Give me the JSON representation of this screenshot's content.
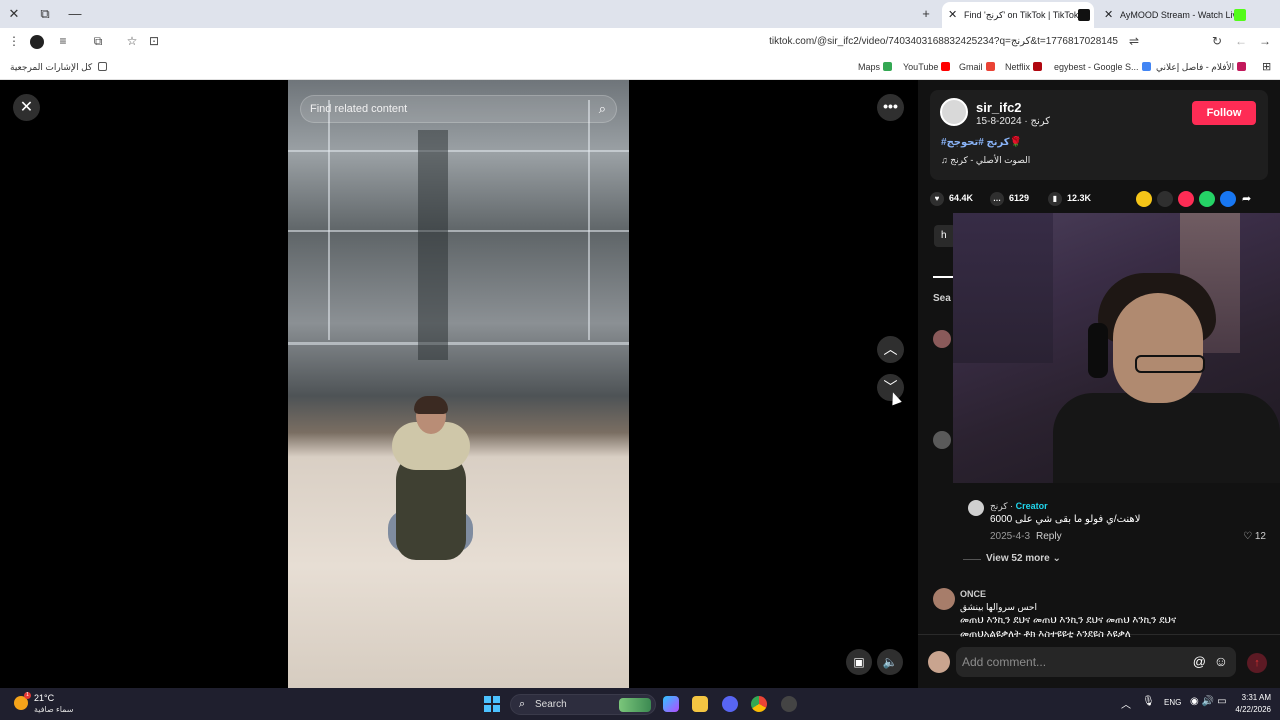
{
  "window": {
    "close": "✕",
    "restore": "⧉",
    "minimize": "—",
    "new_tab": "+"
  },
  "tabs": [
    {
      "label": "Find 'كرنج' on TikTok | TikTok",
      "icon": "tiktok-icon",
      "active": true
    },
    {
      "label": "AyMOOD Stream - Watch Live",
      "icon": "kick-icon",
      "active": false
    }
  ],
  "toolbar": {
    "url": "tiktok.com/@sir_ifc2/video/7403403168832425234?q=كرنج&t=1776817028145"
  },
  "bookmarks": {
    "all": "كل الإشارات المرجعية",
    "items": [
      "Maps",
      "YouTube",
      "Gmail",
      "Netflix",
      "egybest - Google S...",
      "الأفلام - فاصل إعلاني"
    ]
  },
  "video": {
    "search_placeholder": "Find related content"
  },
  "post": {
    "username": "sir_ifc2",
    "subline": "كرنج · 2024-8-15",
    "follow": "Follow",
    "hashtags": "#كرنج #تحوجج🌹",
    "sound": "♫ الصوت الأصلي - كرنج",
    "likes": "64.4K",
    "comments": "6129",
    "saves": "12.3K"
  },
  "comments": {
    "tab_partial": "h",
    "search_partial": "Sea",
    "creator_reply": {
      "name": "كرنج",
      "creator_label": "Creator",
      "text": "لاهنت/ي فولو ما بقى شي على 6000",
      "date": "2025-4-3",
      "reply": "Reply",
      "likes": "12"
    },
    "view_more": "View 52 more",
    "second": {
      "name": "ONCE",
      "line1": "احس سروالها بينشق",
      "line2": "መጠህ እንኪን ደህና መጠህ እንኪን ደህና መጠህ እንኪን ደህና",
      "line3": "መጠህአልዩቃለት ቶክ እስተዩዩቲ እንደዩስ እዩቃለ"
    },
    "input_placeholder": "Add comment..."
  },
  "taskbar": {
    "temp": "21°C",
    "condition": "سماء صافية",
    "search": "Search",
    "lang": "ENG",
    "time": "3:31 AM",
    "date": "4/22/2026",
    "weather_badge": "1"
  },
  "colors": {
    "follow": "#fe2c55",
    "creator": "#20d5ec",
    "hashtag": "#8ab4f8"
  }
}
